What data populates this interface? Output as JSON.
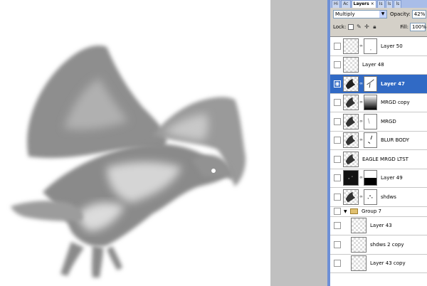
{
  "panel": {
    "tabs": [
      {
        "label": "Hi",
        "active": false
      },
      {
        "label": "Ac",
        "active": false
      },
      {
        "label": "Layers",
        "active": true
      },
      {
        "label": "Is",
        "active": false
      },
      {
        "label": "ls",
        "active": false
      },
      {
        "label": "ls",
        "active": false
      }
    ],
    "close_glyph": "×",
    "blend_mode": "Multiply",
    "blend_arrow": "▼",
    "opacity_label": "Opacity:",
    "opacity_value": "42%",
    "lock_label": "Lock:",
    "fill_label": "Fill:",
    "fill_value": "100%"
  },
  "layers": [
    {
      "name": "Layer 50",
      "thumb": "transparent",
      "mask": "white-dot",
      "visible": false,
      "selected": false
    },
    {
      "name": "Layer 48",
      "thumb": "transparent",
      "mask": null,
      "visible": false,
      "selected": false
    },
    {
      "name": "Layer 47",
      "thumb": "eagle",
      "mask": "eagle-white",
      "visible": true,
      "selected": true
    },
    {
      "name": "MRGD copy",
      "thumb": "eagle",
      "mask": "gradient",
      "visible": false,
      "selected": false
    },
    {
      "name": "MRGD",
      "thumb": "eagle",
      "mask": "white",
      "visible": false,
      "selected": false
    },
    {
      "name": "BLUR BODY",
      "thumb": "eagle",
      "mask": "strokes",
      "visible": false,
      "selected": false
    },
    {
      "name": "EAGLE MRGD LTST",
      "thumb": "eagle",
      "mask": null,
      "visible": false,
      "selected": false
    },
    {
      "name": "Layer 49",
      "thumb": "dark",
      "mask": "half-black",
      "visible": false,
      "selected": false
    },
    {
      "name": "shdws",
      "thumb": "eagle",
      "mask": "dots",
      "visible": false,
      "selected": false
    }
  ],
  "group": {
    "name": "Group 7",
    "expand_glyph": "▼"
  },
  "group_layers": [
    {
      "name": "Layer 43"
    },
    {
      "name": "shdws 2 copy"
    },
    {
      "name": "Layer 43 copy"
    }
  ],
  "icons": {
    "eye": "eye-icon",
    "chain": "link-icon",
    "folder": "folder-icon",
    "lock_transparent": "lock-transparent-icon",
    "lock_brush": "brush-icon",
    "lock_move": "move-icon",
    "lock_all": "lock-icon"
  }
}
